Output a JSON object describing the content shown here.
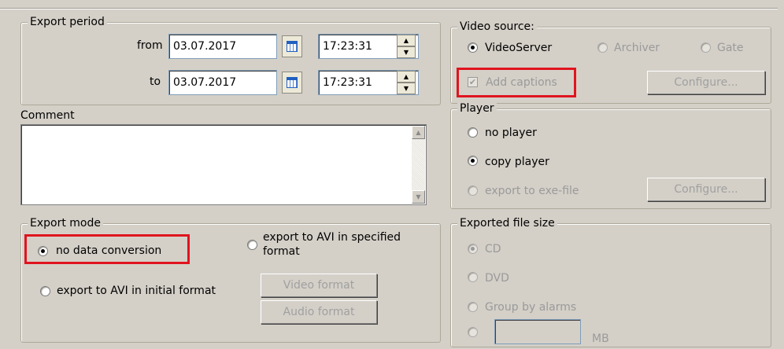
{
  "export_period": {
    "legend": "Export period",
    "from_label": "from",
    "to_label": "to",
    "from_date": "03.07.2017",
    "from_time": "17:23:31",
    "to_date": "03.07.2017",
    "to_time": "17:23:31"
  },
  "comment": {
    "label": "Comment",
    "value": ""
  },
  "export_mode": {
    "legend": "Export mode",
    "no_conversion": "no data conversion",
    "avi_specified": "export to AVI in specified format",
    "avi_initial": "export to AVI in initial format",
    "video_format_button": "Video format",
    "audio_format_button": "Audio format"
  },
  "video_source": {
    "legend": "Video source:",
    "option_videoserver": "VideoServer",
    "option_archiver": "Archiver",
    "option_gate": "Gate",
    "add_captions": "Add captions",
    "configure_button": "Configure..."
  },
  "player": {
    "legend": "Player",
    "no_player": "no player",
    "copy_player": "copy player",
    "export_exe": "export to exe-file",
    "configure_button": "Configure..."
  },
  "file_size": {
    "legend": "Exported file size",
    "cd": "CD",
    "dvd": "DVD",
    "group_by_alarms": "Group by alarms",
    "custom_value": "",
    "unit": "MB"
  },
  "colors": {
    "background": "#d4d0c8",
    "highlight": "#e0141e",
    "disabled_text": "#9a9a9a"
  }
}
